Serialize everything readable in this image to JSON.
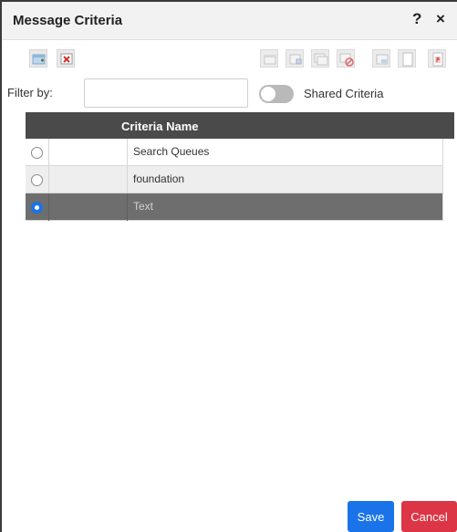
{
  "dialog": {
    "title": "Message Criteria",
    "help_glyph": "?",
    "close_glyph": "×"
  },
  "toolbar": {
    "left_icons": [
      "add-criteria-icon",
      "delete-criteria-icon"
    ],
    "right_icons": [
      "copy-icon",
      "move-icon",
      "duplicate-icon",
      "disable-icon",
      "share-icon",
      "page-icon",
      "pdf-icon"
    ]
  },
  "filter": {
    "label": "Filter by:",
    "value": "",
    "placeholder": ""
  },
  "shared_toggle": {
    "label": "Shared Criteria",
    "on": false
  },
  "grid": {
    "columns": [
      "",
      "",
      "Criteria Name"
    ],
    "rows": [
      {
        "name": "Search Queues",
        "selected": false
      },
      {
        "name": "foundation",
        "selected": false
      },
      {
        "name": "Text",
        "selected": true
      }
    ]
  },
  "buttons": {
    "save_label": "Save",
    "cancel_label": "Cancel"
  },
  "colors": {
    "header": "#4a4a4a",
    "selected_row": "#6e6e6e",
    "save": "#1a73e8",
    "cancel": "#dc3545"
  }
}
